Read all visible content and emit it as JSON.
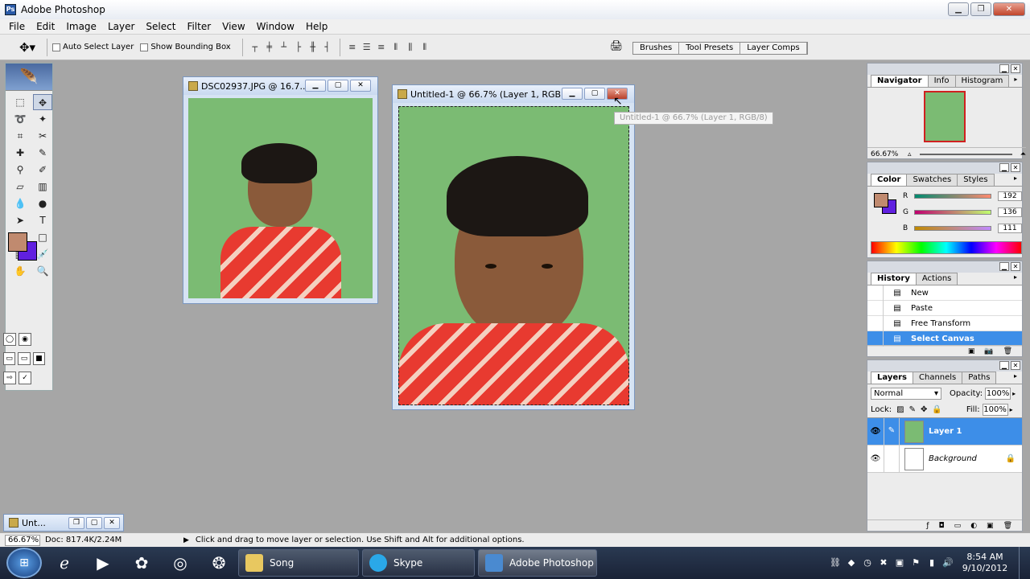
{
  "app": {
    "title": "Adobe Photoshop"
  },
  "menu": [
    "File",
    "Edit",
    "Image",
    "Layer",
    "Select",
    "Filter",
    "View",
    "Window",
    "Help"
  ],
  "options": {
    "auto_select": "Auto Select Layer",
    "show_bbox": "Show Bounding Box",
    "well_tabs": [
      "Brushes",
      "Tool Presets",
      "Layer Comps"
    ]
  },
  "docs": {
    "doc1_title": "DSC02937.JPG @ 16.7...",
    "doc2_title": "Untitled-1 @ 66.7% (Layer 1, RGB...",
    "tooltip": "Untitled-1 @ 66.7% (Layer 1, RGB/8)",
    "minimized_title": "Unt..."
  },
  "status": {
    "zoom": "66.67%",
    "doc": "Doc: 817.4K/2.24M",
    "hint": "Click and drag to move layer or selection.  Use Shift and Alt for additional options."
  },
  "navigator": {
    "tabs": [
      "Navigator",
      "Info",
      "Histogram"
    ],
    "zoom": "66.67%"
  },
  "color": {
    "tabs": [
      "Color",
      "Swatches",
      "Styles"
    ],
    "r_label": "R",
    "g_label": "G",
    "b_label": "B",
    "r": "192",
    "g": "136",
    "b": "111",
    "fg": "#c08a6f",
    "bg": "#6020e0"
  },
  "history": {
    "tabs": [
      "History",
      "Actions"
    ],
    "items": [
      "New",
      "Paste",
      "Free Transform",
      "Select Canvas"
    ]
  },
  "layers": {
    "tabs": [
      "Layers",
      "Channels",
      "Paths"
    ],
    "blend": "Normal",
    "opacity_label": "Opacity:",
    "opacity": "100%",
    "lock_label": "Lock:",
    "fill_label": "Fill:",
    "fill": "100%",
    "items": [
      "Layer 1",
      "Background"
    ]
  },
  "taskbar": {
    "tasks": [
      "Song",
      "Skype",
      "Adobe Photoshop"
    ],
    "time": "8:54 AM",
    "date": "9/10/2012"
  }
}
